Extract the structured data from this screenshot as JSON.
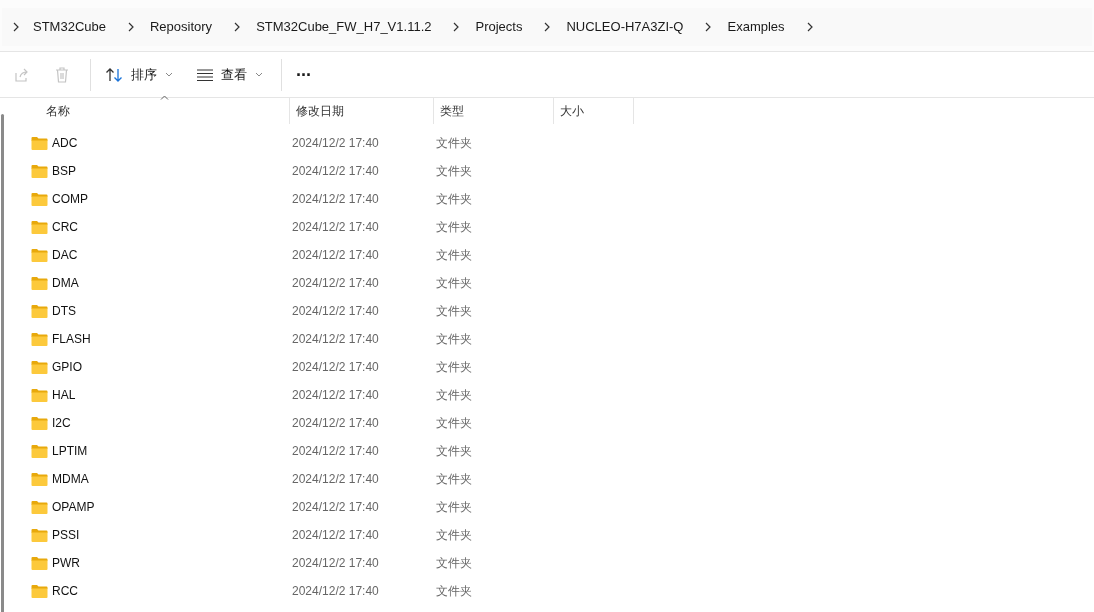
{
  "breadcrumb": [
    "STM32Cube",
    "Repository",
    "STM32Cube_FW_H7_V1.11.2",
    "Projects",
    "NUCLEO-H7A3ZI-Q",
    "Examples"
  ],
  "toolbar": [
    {
      "kind": "share",
      "disabled": true
    },
    {
      "kind": "delete",
      "disabled": true
    },
    {
      "kind": "sort",
      "label": "排序"
    },
    {
      "kind": "view",
      "label": "查看"
    },
    {
      "kind": "more",
      "label": "···"
    }
  ],
  "columns": [
    "名称",
    "修改日期",
    "类型",
    "大小"
  ],
  "rows": [
    {
      "name": "ADC",
      "modified": "2024/12/2 17:40",
      "type": "文件夹"
    },
    {
      "name": "BSP",
      "modified": "2024/12/2 17:40",
      "type": "文件夹"
    },
    {
      "name": "COMP",
      "modified": "2024/12/2 17:40",
      "type": "文件夹"
    },
    {
      "name": "CRC",
      "modified": "2024/12/2 17:40",
      "type": "文件夹"
    },
    {
      "name": "DAC",
      "modified": "2024/12/2 17:40",
      "type": "文件夹"
    },
    {
      "name": "DMA",
      "modified": "2024/12/2 17:40",
      "type": "文件夹"
    },
    {
      "name": "DTS",
      "modified": "2024/12/2 17:40",
      "type": "文件夹"
    },
    {
      "name": "FLASH",
      "modified": "2024/12/2 17:40",
      "type": "文件夹"
    },
    {
      "name": "GPIO",
      "modified": "2024/12/2 17:40",
      "type": "文件夹"
    },
    {
      "name": "HAL",
      "modified": "2024/12/2 17:40",
      "type": "文件夹"
    },
    {
      "name": "I2C",
      "modified": "2024/12/2 17:40",
      "type": "文件夹"
    },
    {
      "name": "LPTIM",
      "modified": "2024/12/2 17:40",
      "type": "文件夹"
    },
    {
      "name": "MDMA",
      "modified": "2024/12/2 17:40",
      "type": "文件夹"
    },
    {
      "name": "OPAMP",
      "modified": "2024/12/2 17:40",
      "type": "文件夹"
    },
    {
      "name": "PSSI",
      "modified": "2024/12/2 17:40",
      "type": "文件夹"
    },
    {
      "name": "PWR",
      "modified": "2024/12/2 17:40",
      "type": "文件夹"
    },
    {
      "name": "RCC",
      "modified": "2024/12/2 17:40",
      "type": "文件夹"
    }
  ]
}
